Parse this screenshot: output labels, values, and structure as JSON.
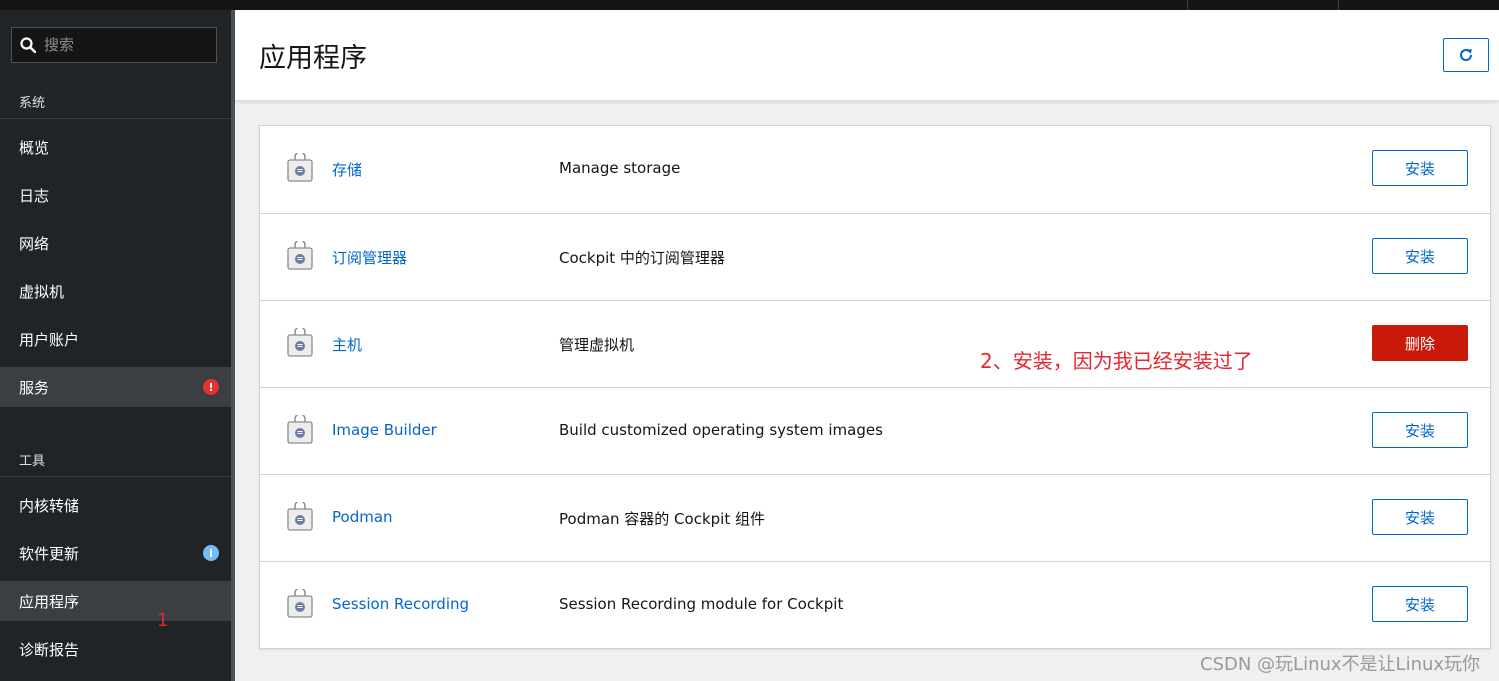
{
  "sidebar": {
    "search": {
      "placeholder": "搜索"
    },
    "sections": [
      {
        "title": "系统",
        "items": [
          {
            "label": "概览"
          },
          {
            "label": "日志"
          },
          {
            "label": "网络"
          },
          {
            "label": "虚拟机"
          },
          {
            "label": "用户账户"
          },
          {
            "label": "服务",
            "active": true,
            "badge": "!"
          }
        ]
      },
      {
        "title": "工具",
        "items": [
          {
            "label": "内核转储"
          },
          {
            "label": "软件更新",
            "badge": "i"
          },
          {
            "label": "应用程序",
            "active": true
          },
          {
            "label": "诊断报告"
          }
        ]
      }
    ],
    "annotation": "1"
  },
  "main": {
    "title": "应用程序",
    "refresh_icon": "refresh-icon",
    "apps": [
      {
        "name": "存储",
        "description": "Manage storage",
        "action": "安装",
        "action_type": "install"
      },
      {
        "name": "订阅管理器",
        "description": "Cockpit 中的订阅管理器",
        "action": "安装",
        "action_type": "install"
      },
      {
        "name": "主机",
        "description": "管理虚拟机",
        "action": "删除",
        "action_type": "remove"
      },
      {
        "name": "Image Builder",
        "description": "Build customized operating system images",
        "action": "安装",
        "action_type": "install"
      },
      {
        "name": "Podman",
        "description": "Podman 容器的 Cockpit 组件",
        "action": "安装",
        "action_type": "install"
      },
      {
        "name": "Session Recording",
        "description": "Session Recording module for Cockpit",
        "action": "安装",
        "action_type": "install"
      }
    ],
    "annotation": "2、安装，因为我已经安装过了"
  },
  "watermark": "CSDN @玩Linux不是让Linux玩你",
  "colors": {
    "link": "#0066cc",
    "danger": "#c9190b",
    "sidebar_bg": "#212427",
    "annotation": "#e4262f"
  }
}
